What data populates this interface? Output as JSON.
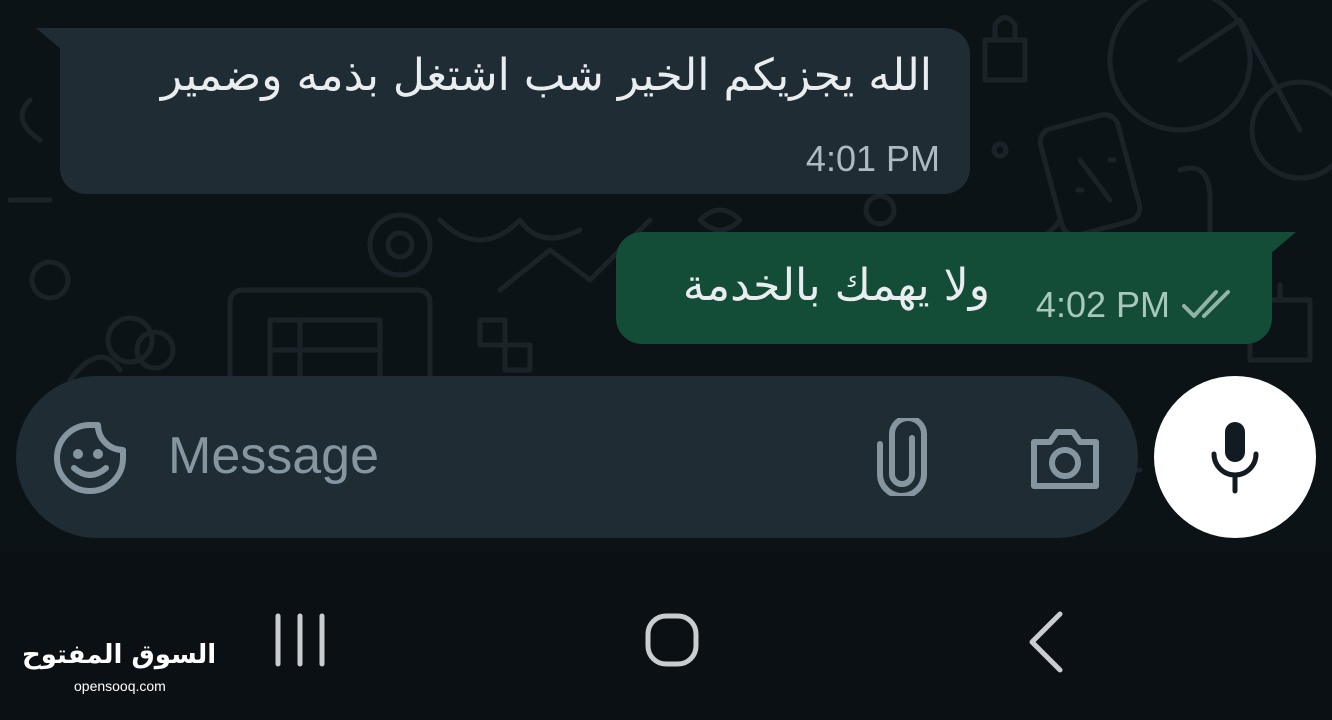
{
  "conversation": {
    "messages": [
      {
        "direction": "incoming",
        "text": "الله يجزيكم الخير شب اشتغل بذمه وضمير",
        "time": "4:01 PM"
      },
      {
        "direction": "outgoing",
        "text": "ولا يهمك بالخدمة",
        "time": "4:02 PM",
        "status_icon": "double-check-icon"
      }
    ]
  },
  "composer": {
    "placeholder": "Message",
    "icons": [
      "sticker-icon",
      "paperclip-icon",
      "camera-icon"
    ]
  },
  "mic_button": {
    "icon": "microphone-icon"
  },
  "navbar": {
    "icons": [
      "recent-apps-icon",
      "home-icon",
      "back-icon"
    ]
  },
  "watermark": {
    "arabic": "السوق المفتوح",
    "latin": "opensooq.com"
  },
  "colors": {
    "chat_background": "#0c1317",
    "incoming_bubble": "#202c33",
    "outgoing_bubble": "#144d37",
    "composer": "#1f2c33",
    "icon_gray": "#8696a0"
  }
}
